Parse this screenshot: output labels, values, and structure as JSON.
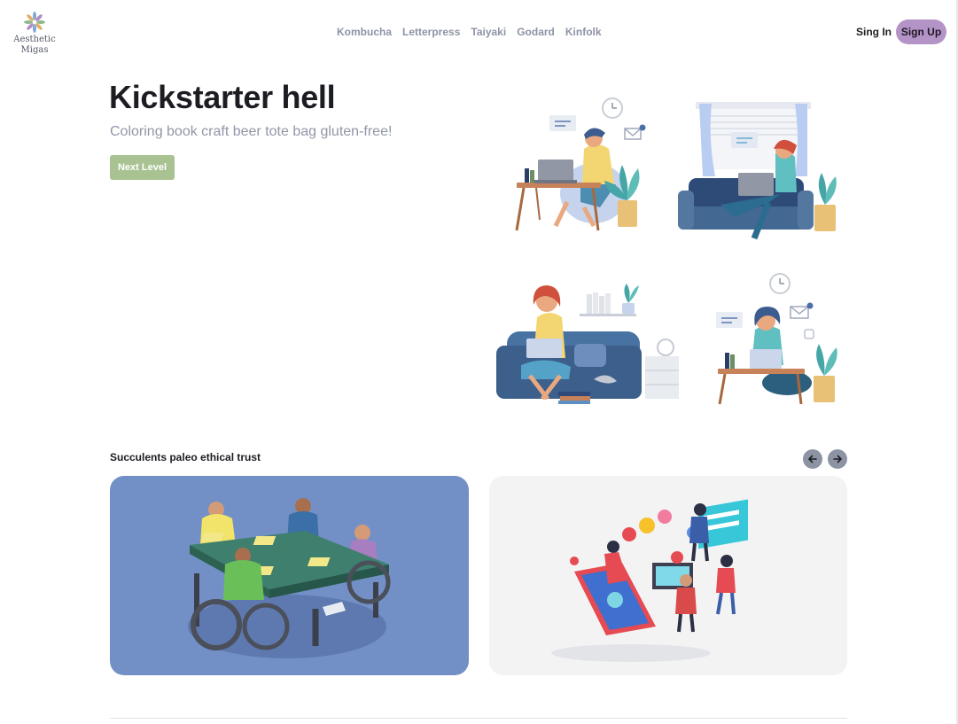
{
  "brand": {
    "line1": "Aesthetic",
    "line2": "Migas"
  },
  "nav": {
    "items": [
      "Kombucha",
      "Letterpress",
      "Taiyaki",
      "Godard",
      "Kinfolk"
    ]
  },
  "auth": {
    "sign_in": "Sing In",
    "sign_up": "Sign Up"
  },
  "hero": {
    "title": "Kickstarter hell",
    "subtitle": "Coloring book craft beer tote bag gluten-free!",
    "cta_label": "Next Level"
  },
  "section": {
    "title": "Succulents paleo ethical trust"
  },
  "colors": {
    "accent_button": "#a8c291",
    "signup_pill": "#b493c6",
    "card_blue": "#7290c6",
    "nav_text": "#8e93a6"
  },
  "icons": [
    "flower-logo-icon",
    "arrow-left-icon",
    "arrow-right-icon"
  ]
}
